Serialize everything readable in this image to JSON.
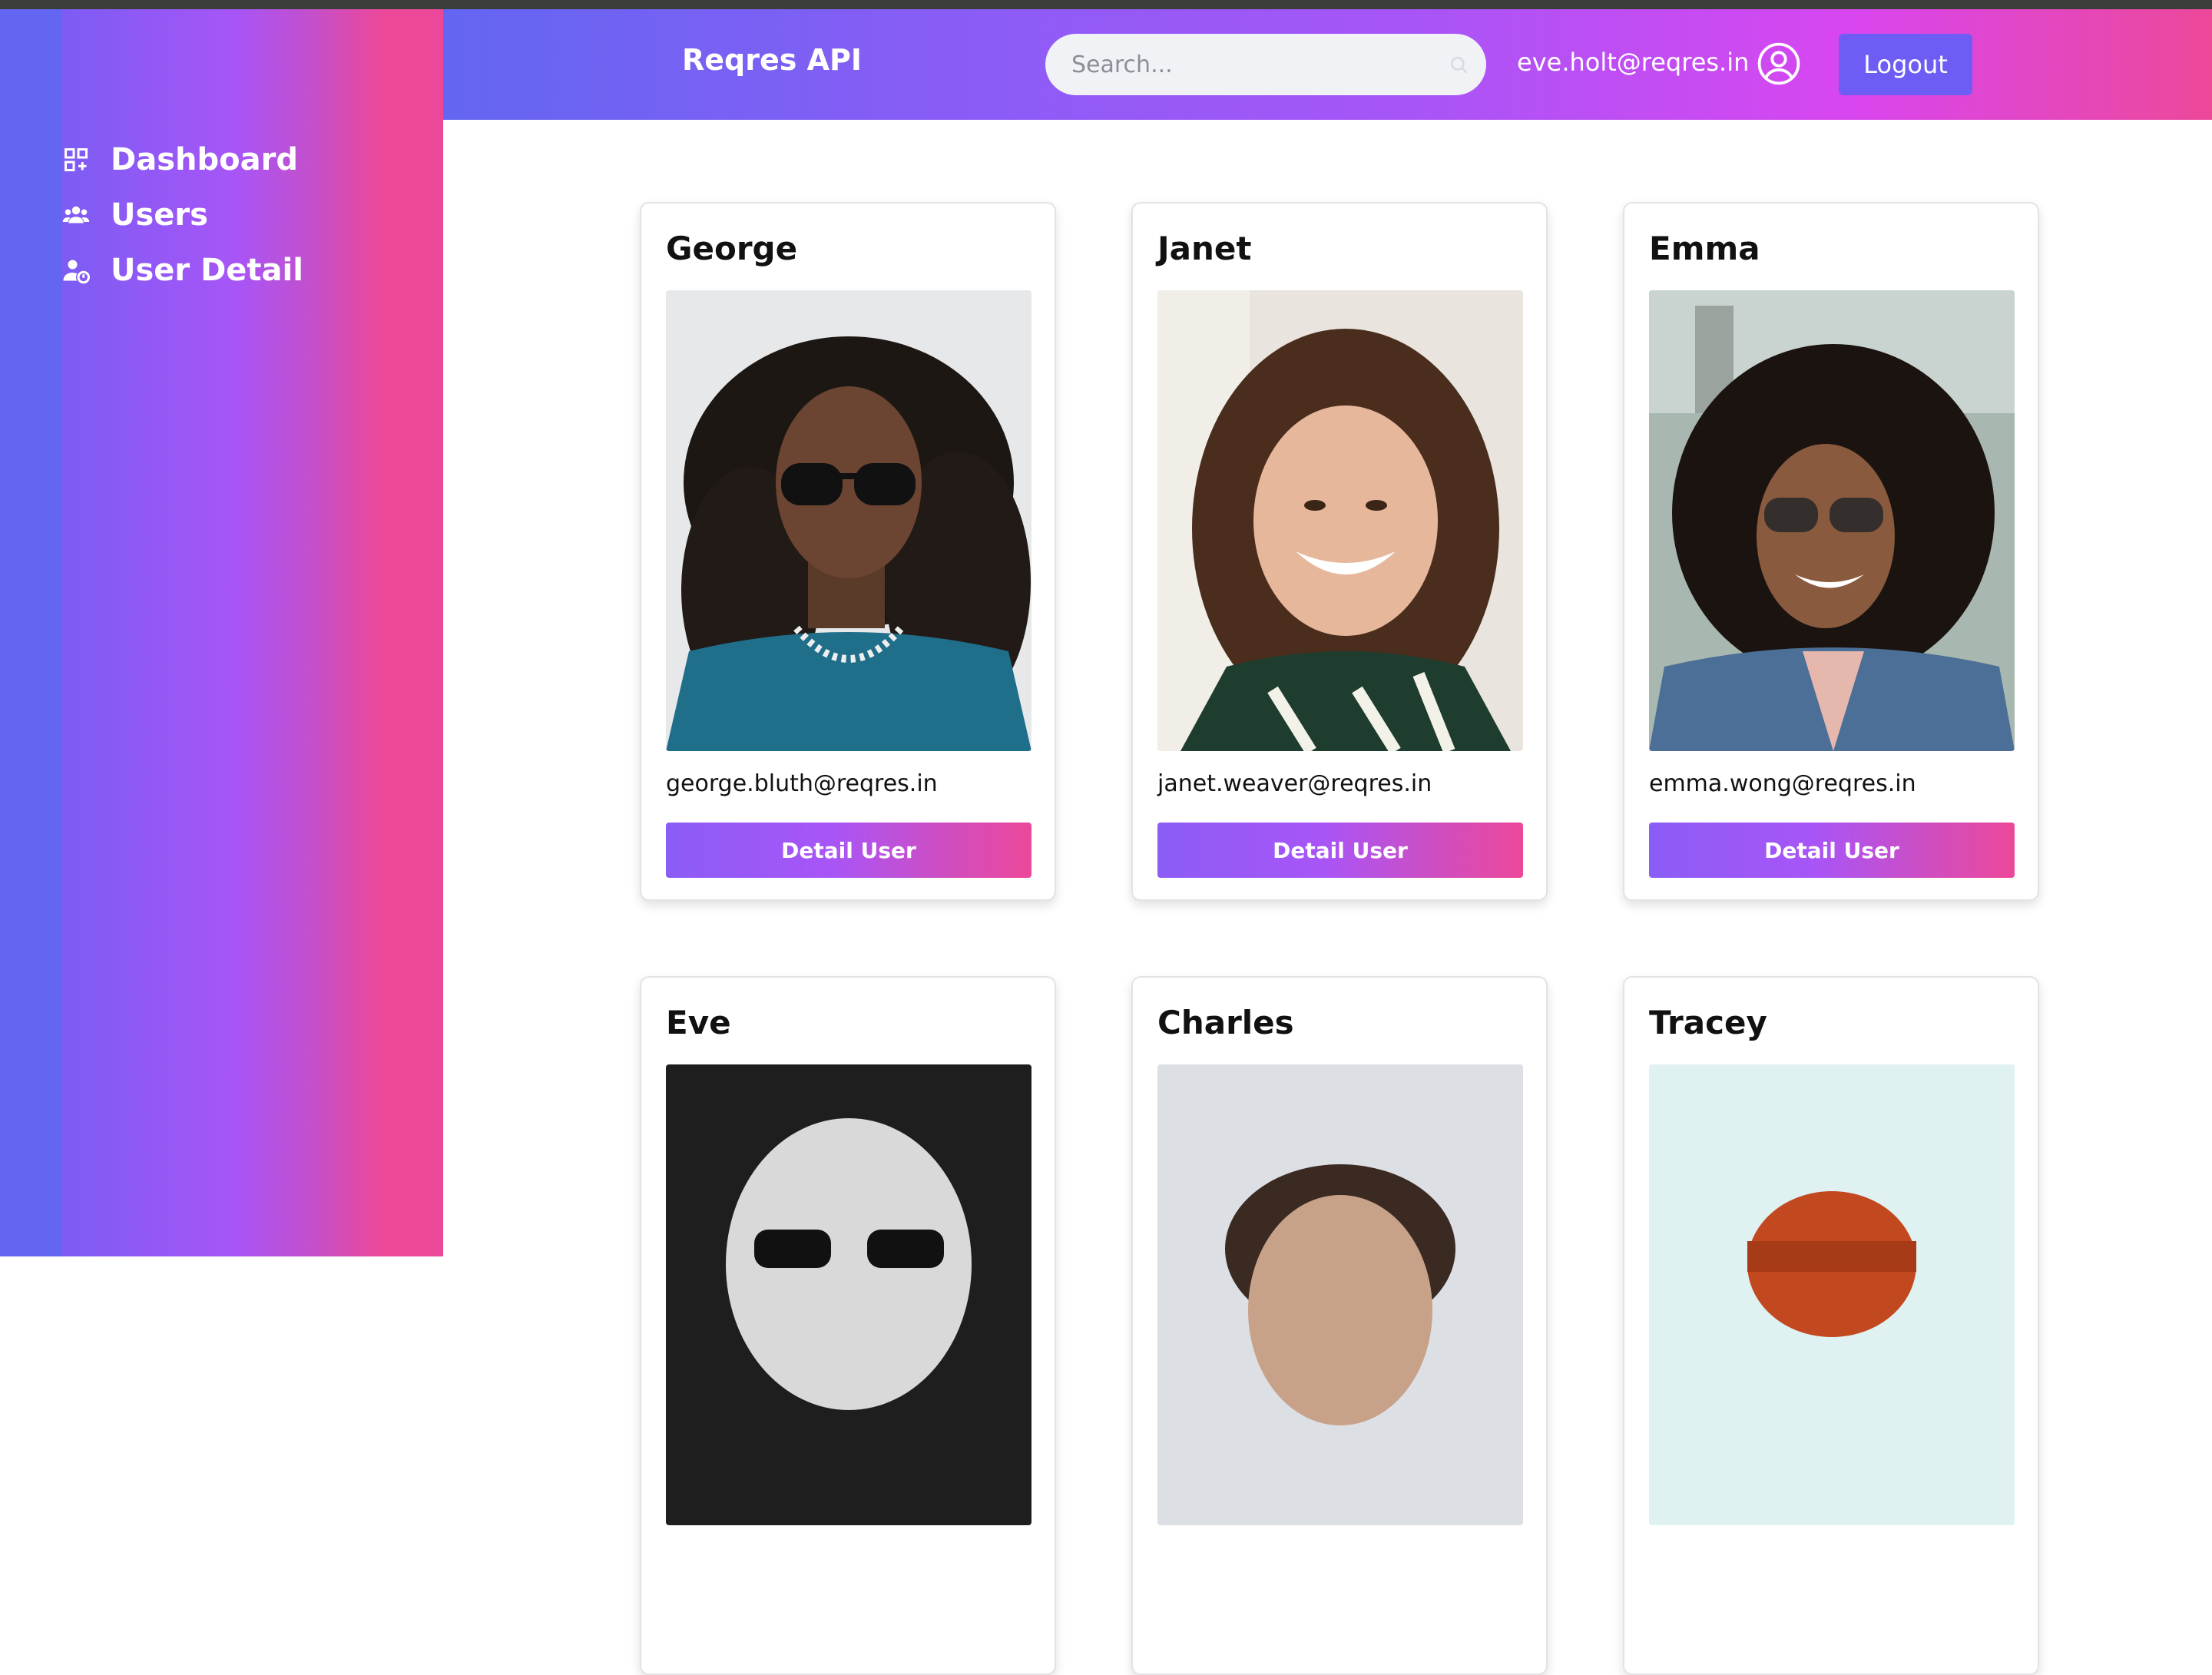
{
  "header": {
    "brand": "Reqres API",
    "search_placeholder": "Search...",
    "user_email": "eve.holt@reqres.in",
    "logout_label": "Logout"
  },
  "sidebar": {
    "items": [
      {
        "label": "Dashboard",
        "icon": "dashboard-grid-icon"
      },
      {
        "label": "Users",
        "icon": "users-group-icon"
      },
      {
        "label": "User Detail",
        "icon": "user-detail-icon"
      }
    ]
  },
  "users": [
    {
      "name": "George",
      "email": "george.bluth@reqres.in",
      "button": "Detail User"
    },
    {
      "name": "Janet",
      "email": "janet.weaver@reqres.in",
      "button": "Detail User"
    },
    {
      "name": "Emma",
      "email": "emma.wong@reqres.in",
      "button": "Detail User"
    },
    {
      "name": "Eve",
      "email": "",
      "button": ""
    },
    {
      "name": "Charles",
      "email": "",
      "button": ""
    },
    {
      "name": "Tracey",
      "email": "",
      "button": ""
    }
  ],
  "colors": {
    "accent_indigo": "#6366f1",
    "accent_purple": "#a855f7",
    "accent_pink": "#ec4899",
    "logout_bg": "#6d5df5"
  }
}
